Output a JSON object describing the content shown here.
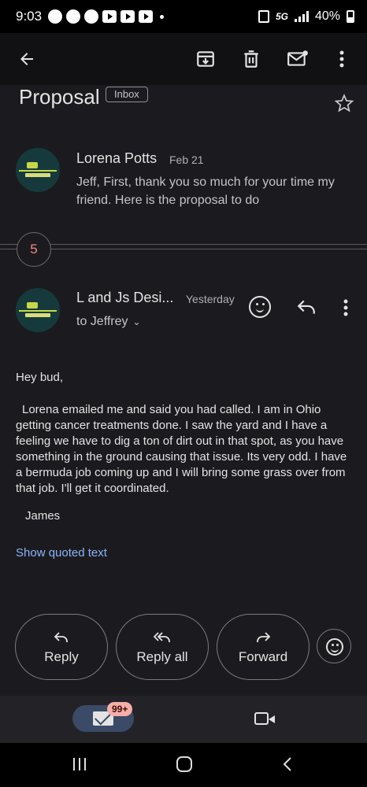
{
  "status_bar": {
    "time": "9:03",
    "network": "5G",
    "battery": "40%"
  },
  "toolbar": {
    "back_icon": "back-arrow-icon",
    "archive_icon": "archive-icon",
    "delete_icon": "trash-icon",
    "mark_unread_icon": "mark-unread-icon",
    "more_icon": "more-vert-icon"
  },
  "thread": {
    "subject": "Proposal",
    "label": "Inbox",
    "collapsed_count": "5"
  },
  "messages": [
    {
      "sender": "Lorena Potts",
      "date": "Feb 21",
      "snippet": "Jeff, First, thank you so much for your time my friend. Here is the proposal to do"
    },
    {
      "sender": "L and Js Desi...",
      "date": "Yesterday",
      "recipient": "to Jeffrey",
      "greeting": "Hey bud,",
      "body": "Lorena emailed me and said you had called.  I am in Ohio getting cancer treatments done. I saw the yard and I have a feeling we have to dig a ton of dirt out in that spot, as you have something in the ground causing that issue. Its very odd. I have a bermuda job coming up and I will bring some grass over from that job. I'll get it coordinated.",
      "signature": "James",
      "show_quoted": "Show quoted text"
    }
  ],
  "actions": {
    "reply": "Reply",
    "reply_all": "Reply all",
    "forward": "Forward"
  },
  "bottom_nav": {
    "mail_badge": "99+"
  },
  "colors": {
    "background": "#1b1b1f",
    "link": "#8ab4f8",
    "badge": "#f6aea9",
    "count_text": "#f28b82"
  }
}
